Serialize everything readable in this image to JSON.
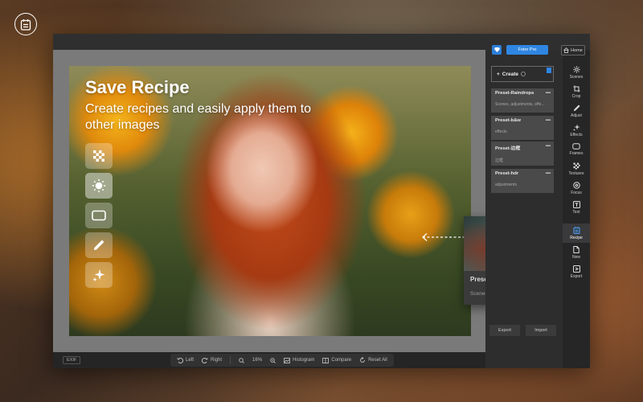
{
  "overlay": {
    "title": "Save Recipe",
    "subtitle": "Create recipes and easily apply them to other images"
  },
  "photo_tools": [
    {
      "icon": "mosaic-icon"
    },
    {
      "icon": "sun-icon"
    },
    {
      "icon": "frame-icon"
    },
    {
      "icon": "pencil-icon"
    },
    {
      "icon": "sparkle-icon"
    }
  ],
  "floating_recipe": {
    "name": "Preset-Raindrops",
    "menu": "•••",
    "desc": "Scenes, adjustments, effe..."
  },
  "panel": {
    "pro_label": "Fotor Pro",
    "create_label": "Create",
    "presets": [
      {
        "name": "Preset-Raindrops",
        "desc": "Scenes, adjustments, effe...",
        "menu": "•••"
      },
      {
        "name": "Preset-b&w",
        "desc": "effects",
        "menu": "•••"
      },
      {
        "name": "Preset-边框",
        "desc": "边框",
        "menu": "•••"
      },
      {
        "name": "Preset-hdr",
        "desc": "adjustments",
        "menu": "•••"
      }
    ],
    "export_label": "Export",
    "import_label": "Import"
  },
  "home_label": "Home",
  "rail": [
    {
      "label": "Scenes",
      "icon": "scenes-icon"
    },
    {
      "label": "Crop",
      "icon": "crop-icon"
    },
    {
      "label": "Adjust",
      "icon": "adjust-icon"
    },
    {
      "label": "Effects",
      "icon": "effects-icon"
    },
    {
      "label": "Frames",
      "icon": "frames-icon"
    },
    {
      "label": "Textures",
      "icon": "textures-icon"
    },
    {
      "label": "Focus",
      "icon": "focus-icon"
    },
    {
      "label": "Text",
      "icon": "text-icon"
    },
    {
      "label": "Recipe",
      "icon": "recipe-icon",
      "active": true
    },
    {
      "label": "New",
      "icon": "new-icon"
    },
    {
      "label": "Export",
      "icon": "export-icon"
    }
  ],
  "statusbar": {
    "exif": "EXIF",
    "rotate_left": "Left",
    "rotate_right": "Right",
    "zoom": "16%",
    "histogram": "Histogram",
    "compare": "Compare",
    "reset": "Reset  All"
  },
  "colors": {
    "accent": "#2f86e2",
    "panel_bg": "#2d2d2e",
    "canvas_bg": "#7a7a7a"
  }
}
